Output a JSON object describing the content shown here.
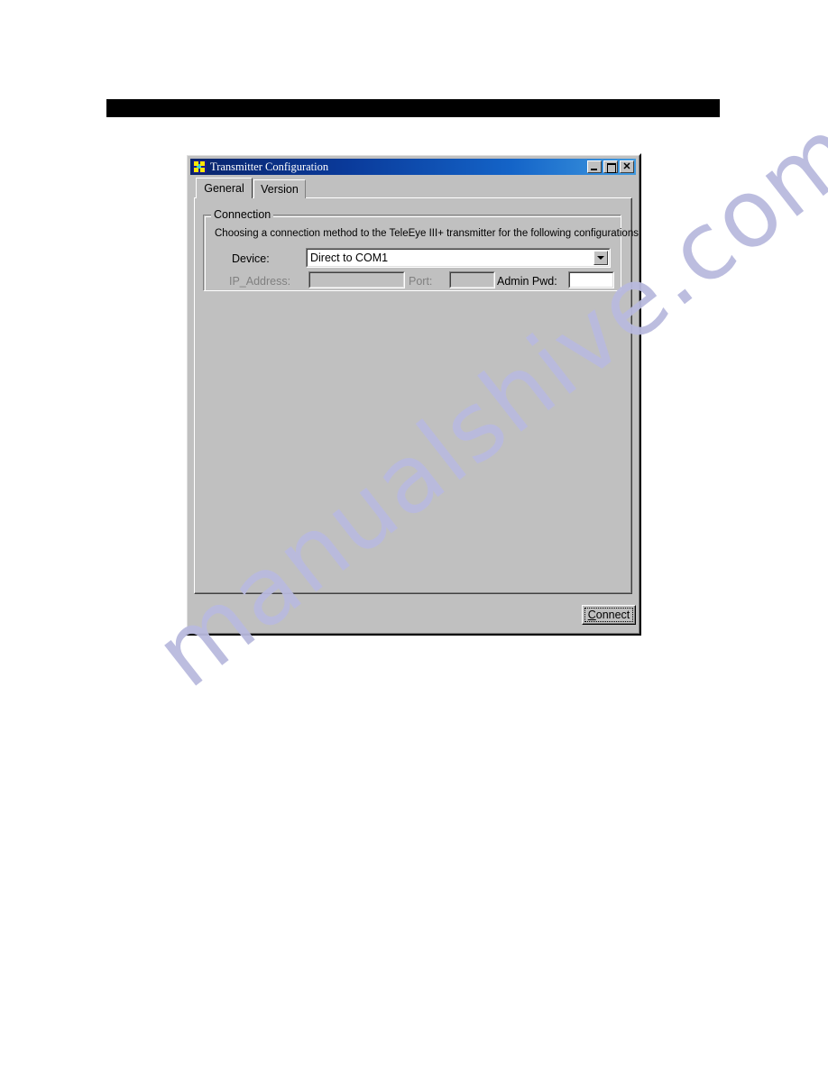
{
  "page": {
    "redaction_bar": "",
    "watermark_text": "manualshive.com",
    "watermark_color": "#b9bade",
    "background_color": "#ffffff"
  },
  "window": {
    "title": "Transmitter Configuration",
    "icon": "app-icon",
    "titlebar_gradient_start": "#09246b",
    "titlebar_gradient_end": "#3f9ae0",
    "face_color": "#c0c0c0",
    "controls": {
      "minimize_label": "–",
      "maximize_label": "□",
      "close_label": "✕"
    }
  },
  "tabs": [
    {
      "label": "General",
      "active": true
    },
    {
      "label": "Version",
      "active": false
    }
  ],
  "group": {
    "title": "Connection",
    "instruction": "Choosing a connection method to the TeleEye III+ transmitter for the following configurations"
  },
  "form": {
    "device": {
      "label": "Device:",
      "value": "Direct to COM1",
      "enabled": true,
      "options": [
        "Direct to COM1"
      ]
    },
    "ip_address": {
      "label": "IP_Address:",
      "value": "",
      "placeholder": "",
      "enabled": false
    },
    "port": {
      "label": "Port:",
      "value": "",
      "placeholder": "",
      "enabled": false
    },
    "admin_pwd": {
      "label": "Admin Pwd:",
      "value": "",
      "placeholder": "",
      "enabled": true
    }
  },
  "footer": {
    "connect_mnemonic": "C",
    "connect_rest": "onnect",
    "connect_label": "Connect"
  }
}
